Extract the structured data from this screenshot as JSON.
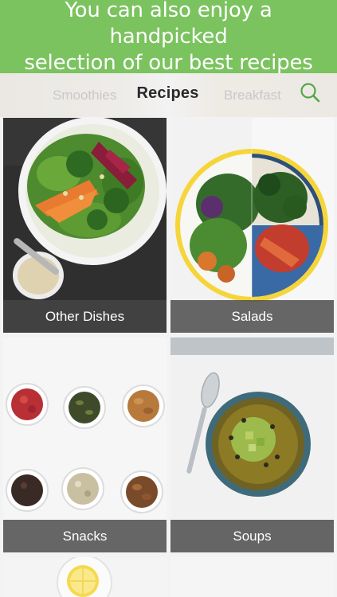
{
  "banner": {
    "line1": "You can also enjoy a handpicked",
    "line2": "selection of our best recipes"
  },
  "nav": {
    "title": "Recipes",
    "left_category": "Smoothies",
    "right_category": "Breakfast",
    "search_icon": "search-icon"
  },
  "categories": [
    {
      "label": "Other Dishes",
      "icon": "salad-bowl-photo"
    },
    {
      "label": "Salads",
      "icon": "salad-plate-photo"
    },
    {
      "label": "Snacks",
      "icon": "snack-bowls-photo"
    },
    {
      "label": "Soups",
      "icon": "soup-bowl-photo"
    }
  ],
  "colors": {
    "banner": "#7bc35f",
    "accent_green": "#55a64a",
    "label_bar": "#464646"
  }
}
